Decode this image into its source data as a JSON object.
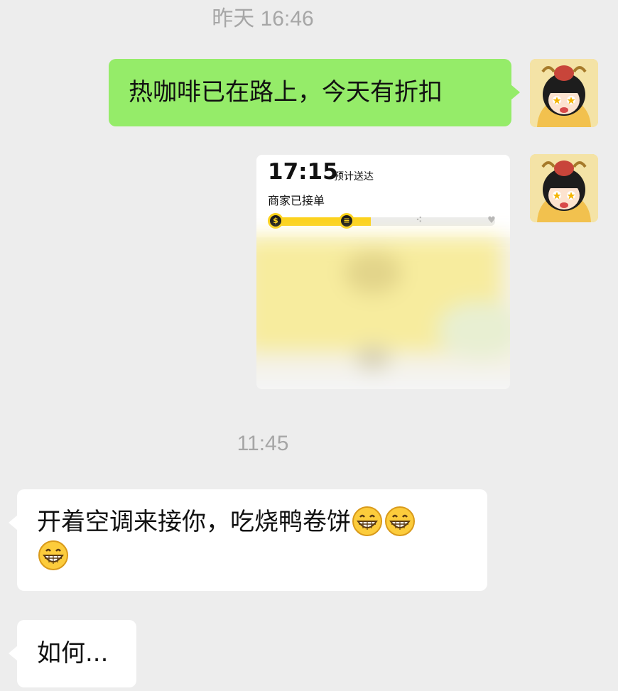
{
  "chat": {
    "timestamp_1": "昨天 16:46",
    "timestamp_2": "11:45",
    "messages": [
      {
        "text": "热咖啡已在路上，今天有折扣"
      },
      {
        "text": "开着空调来接你，吃烧鸭卷饼"
      },
      {
        "text": "如何..."
      }
    ],
    "emoji_name": "grin-emoji",
    "emoji_count": 3
  },
  "delivery_card": {
    "eta_time": "17:15",
    "eta_label": "预计送达",
    "status": "商家已接单",
    "progress": 0.45,
    "steps": [
      {
        "icon": "coin-icon",
        "state": "done"
      },
      {
        "icon": "shop-icon",
        "state": "done"
      },
      {
        "icon": "route-icon",
        "state": "pending"
      },
      {
        "icon": "location-icon",
        "state": "pending"
      }
    ]
  },
  "colors": {
    "chat_bg": "#ededed",
    "sent_bubble": "#95ec69",
    "received_bubble": "#ffffff",
    "accent_yellow": "#fcd21c",
    "timestamp": "#a6a6a6"
  }
}
